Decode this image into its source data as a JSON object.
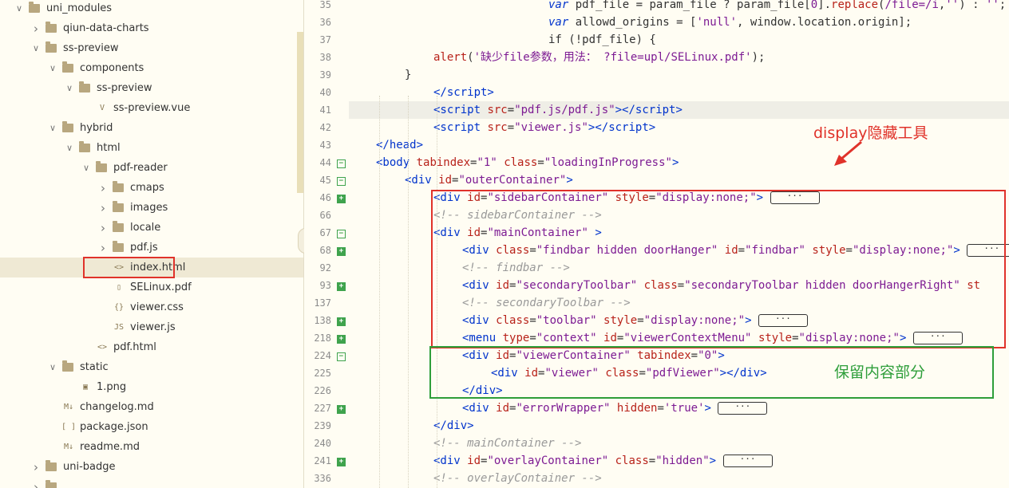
{
  "tree": {
    "items": [
      {
        "label": "uni_modules",
        "state": "open",
        "kind": "folder",
        "depth": 0
      },
      {
        "label": "qiun-data-charts",
        "state": "closed",
        "kind": "folder",
        "depth": 1
      },
      {
        "label": "ss-preview",
        "state": "open",
        "kind": "folder",
        "depth": 1
      },
      {
        "label": "components",
        "state": "open",
        "kind": "folder",
        "depth": 2
      },
      {
        "label": "ss-preview",
        "state": "open",
        "kind": "folder",
        "depth": 3
      },
      {
        "label": "ss-preview.vue",
        "state": "none",
        "kind": "vue",
        "depth": 4
      },
      {
        "label": "hybrid",
        "state": "open",
        "kind": "folder",
        "depth": 2
      },
      {
        "label": "html",
        "state": "open",
        "kind": "folder",
        "depth": 3
      },
      {
        "label": "pdf-reader",
        "state": "open",
        "kind": "folder",
        "depth": 4
      },
      {
        "label": "cmaps",
        "state": "closed",
        "kind": "folder",
        "depth": 5
      },
      {
        "label": "images",
        "state": "closed",
        "kind": "folder",
        "depth": 5
      },
      {
        "label": "locale",
        "state": "closed",
        "kind": "folder",
        "depth": 5
      },
      {
        "label": "pdf.js",
        "state": "closed",
        "kind": "folder",
        "depth": 5
      },
      {
        "label": "index.html",
        "state": "none",
        "kind": "html",
        "depth": 5,
        "selected": true
      },
      {
        "label": "SELinux.pdf",
        "state": "none",
        "kind": "file",
        "depth": 5
      },
      {
        "label": "viewer.css",
        "state": "none",
        "kind": "css",
        "depth": 5
      },
      {
        "label": "viewer.js",
        "state": "none",
        "kind": "js",
        "depth": 5
      },
      {
        "label": "pdf.html",
        "state": "none",
        "kind": "html",
        "depth": 4
      },
      {
        "label": "static",
        "state": "open",
        "kind": "folder",
        "depth": 2
      },
      {
        "label": "1.png",
        "state": "none",
        "kind": "img",
        "depth": 3
      },
      {
        "label": "changelog.md",
        "state": "none",
        "kind": "md",
        "depth": 2
      },
      {
        "label": "package.json",
        "state": "none",
        "kind": "json",
        "depth": 2
      },
      {
        "label": "readme.md",
        "state": "none",
        "kind": "md",
        "depth": 2
      },
      {
        "label": "uni-badge",
        "state": "closed",
        "kind": "folder",
        "depth": 1
      },
      {
        "label": "",
        "state": "closed",
        "kind": "folder",
        "depth": 1
      }
    ]
  },
  "editor": {
    "lines": [
      {
        "n": "35",
        "fold": "",
        "indent": 6,
        "html": "<span class=\"c-kw\">var</span> pdf_file = param_file ? param_file[<span class=\"c-str\">0</span>].<span class=\"c-fn\">replace</span>(<span class=\"c-str\">/file=/i</span>,<span class=\"c-str\">''</span>) : <span class=\"c-str\">''</span>;"
      },
      {
        "n": "36",
        "fold": "",
        "indent": 6,
        "html": "<span class=\"c-kw\">var</span> allowd_origins = [<span class=\"c-str\">'null'</span>, window.location.origin];"
      },
      {
        "n": "37",
        "fold": "",
        "indent": 6,
        "html": "if (!pdf_file) {"
      },
      {
        "n": "38",
        "fold": "",
        "indent": 2,
        "html": "<span class=\"c-fn\">alert</span>(<span class=\"c-str\">'缺少file参数，用法： ?file=upl/SELinux.pdf'</span>);"
      },
      {
        "n": "39",
        "fold": "",
        "indent": 1,
        "html": "}"
      },
      {
        "n": "40",
        "fold": "",
        "indent": 2,
        "html": "<span class=\"c-tag\">&lt;/script&gt;</span>"
      },
      {
        "n": "41",
        "fold": "",
        "indent": 2,
        "cur": true,
        "html": "<span class=\"c-tag\">&lt;script</span> <span class=\"c-attr\">src</span>=<span class=\"c-str\">\"pdf.js/pdf.js\"</span><span class=\"c-tag\">&gt;&lt;/script&gt;</span>"
      },
      {
        "n": "42",
        "fold": "",
        "indent": 2,
        "html": "<span class=\"c-tag\">&lt;script</span> <span class=\"c-attr\">src</span>=<span class=\"c-str\">\"viewer.js\"</span><span class=\"c-tag\">&gt;&lt;/script&gt;</span>"
      },
      {
        "n": "43",
        "fold": "",
        "indent": 0,
        "html": "<span class=\"c-tag\">&lt;/head&gt;</span>"
      },
      {
        "n": "44",
        "fold": "minus",
        "indent": 0,
        "html": "<span class=\"c-tag\">&lt;body</span> <span class=\"c-attr\">tabindex</span>=<span class=\"c-str\">\"1\"</span> <span class=\"c-attr\">class</span>=<span class=\"c-str\">\"loadingInProgress\"</span><span class=\"c-tag\">&gt;</span>"
      },
      {
        "n": "45",
        "fold": "minus",
        "indent": 1,
        "html": "<span class=\"c-tag\">&lt;div</span> <span class=\"c-attr\">id</span>=<span class=\"c-str\">\"outerContainer\"</span><span class=\"c-tag\">&gt;</span>"
      },
      {
        "n": "46",
        "fold": "plus",
        "indent": 2,
        "html": "<span class=\"c-tag\">&lt;div</span> <span class=\"c-attr\">id</span>=<span class=\"c-str\">\"sidebarContainer\"</span> <span class=\"c-attr\">style</span>=<span class=\"c-str\">\"display:none;\"</span><span class=\"c-tag\">&gt;</span> <span class=\"pill\">···</span>"
      },
      {
        "n": "66",
        "fold": "",
        "indent": 2,
        "html": "<span class=\"c-com\">&lt;!-- sidebarContainer --&gt;</span>"
      },
      {
        "n": "67",
        "fold": "minus",
        "indent": 2,
        "html": "<span class=\"c-tag\">&lt;div</span> <span class=\"c-attr\">id</span>=<span class=\"c-str\">\"mainContainer\"</span> <span class=\"c-tag\">&gt;</span>"
      },
      {
        "n": "68",
        "fold": "plus",
        "indent": 3,
        "html": "<span class=\"c-tag\">&lt;div</span> <span class=\"c-attr\">class</span>=<span class=\"c-str\">\"findbar hidden doorHanger\"</span> <span class=\"c-attr\">id</span>=<span class=\"c-str\">\"findbar\"</span> <span class=\"c-attr\">style</span>=<span class=\"c-str\">\"display:none;\"</span><span class=\"c-tag\">&gt;</span> <span class=\"pill\">···</span>"
      },
      {
        "n": "92",
        "fold": "",
        "indent": 3,
        "html": "<span class=\"c-com\">&lt;!-- findbar --&gt;</span>"
      },
      {
        "n": "93",
        "fold": "plus",
        "indent": 3,
        "html": "<span class=\"c-tag\">&lt;div</span> <span class=\"c-attr\">id</span>=<span class=\"c-str\">\"secondaryToolbar\"</span> <span class=\"c-attr\">class</span>=<span class=\"c-str\">\"secondaryToolbar hidden doorHangerRight\"</span> <span class=\"c-attr\">st</span>"
      },
      {
        "n": "137",
        "fold": "",
        "indent": 3,
        "html": "<span class=\"c-com\">&lt;!-- secondaryToolbar --&gt;</span>"
      },
      {
        "n": "138",
        "fold": "plus",
        "indent": 3,
        "html": "<span class=\"c-tag\">&lt;div</span> <span class=\"c-attr\">class</span>=<span class=\"c-str\">\"toolbar\"</span> <span class=\"c-attr\">style</span>=<span class=\"c-str\">\"display:none;\"</span><span class=\"c-tag\">&gt;</span> <span class=\"pill\">···</span>"
      },
      {
        "n": "218",
        "fold": "plus",
        "indent": 3,
        "html": "<span class=\"c-tag\">&lt;menu</span> <span class=\"c-attr\">type</span>=<span class=\"c-str\">\"context\"</span> <span class=\"c-attr\">id</span>=<span class=\"c-str\">\"viewerContextMenu\"</span> <span class=\"c-attr\">style</span>=<span class=\"c-str\">\"display:none;\"</span><span class=\"c-tag\">&gt;</span> <span class=\"pill\">···</span>"
      },
      {
        "n": "224",
        "fold": "minus",
        "indent": 3,
        "html": "<span class=\"c-tag\">&lt;div</span> <span class=\"c-attr\">id</span>=<span class=\"c-str\">\"viewerContainer\"</span> <span class=\"c-attr\">tabindex</span>=<span class=\"c-str\">\"0\"</span><span class=\"c-tag\">&gt;</span>"
      },
      {
        "n": "225",
        "fold": "",
        "indent": 4,
        "html": "<span class=\"c-tag\">&lt;div</span> <span class=\"c-attr\">id</span>=<span class=\"c-str\">\"viewer\"</span> <span class=\"c-attr\">class</span>=<span class=\"c-str\">\"pdfViewer\"</span><span class=\"c-tag\">&gt;&lt;/div&gt;</span>"
      },
      {
        "n": "226",
        "fold": "",
        "indent": 3,
        "html": "<span class=\"c-tag\">&lt;/div&gt;</span>"
      },
      {
        "n": "227",
        "fold": "plus",
        "indent": 3,
        "html": "<span class=\"c-tag\">&lt;div</span> <span class=\"c-attr\">id</span>=<span class=\"c-str\">\"errorWrapper\"</span> <span class=\"c-attr\">hidden</span>=<span class=\"c-str\">'true'</span><span class=\"c-tag\">&gt;</span> <span class=\"pill\">···</span>"
      },
      {
        "n": "239",
        "fold": "",
        "indent": 2,
        "html": "<span class=\"c-tag\">&lt;/div&gt;</span>"
      },
      {
        "n": "240",
        "fold": "",
        "indent": 2,
        "html": "<span class=\"c-com\">&lt;!-- mainContainer --&gt;</span>"
      },
      {
        "n": "241",
        "fold": "plus",
        "indent": 2,
        "html": "<span class=\"c-tag\">&lt;div</span> <span class=\"c-attr\">id</span>=<span class=\"c-str\">\"overlayContainer\"</span> <span class=\"c-attr\">class</span>=<span class=\"c-str\">\"hidden\"</span><span class=\"c-tag\">&gt;</span> <span class=\"pill\">···</span>"
      },
      {
        "n": "336",
        "fold": "",
        "indent": 2,
        "html": "<span class=\"c-com\">&lt;!-- overlayContainer --&gt;</span>"
      }
    ]
  },
  "annotations": {
    "hide_label": "display隐藏工具",
    "keep_label": "保留内容部分",
    "red": "#e0322a",
    "green": "#2e9e3a"
  }
}
